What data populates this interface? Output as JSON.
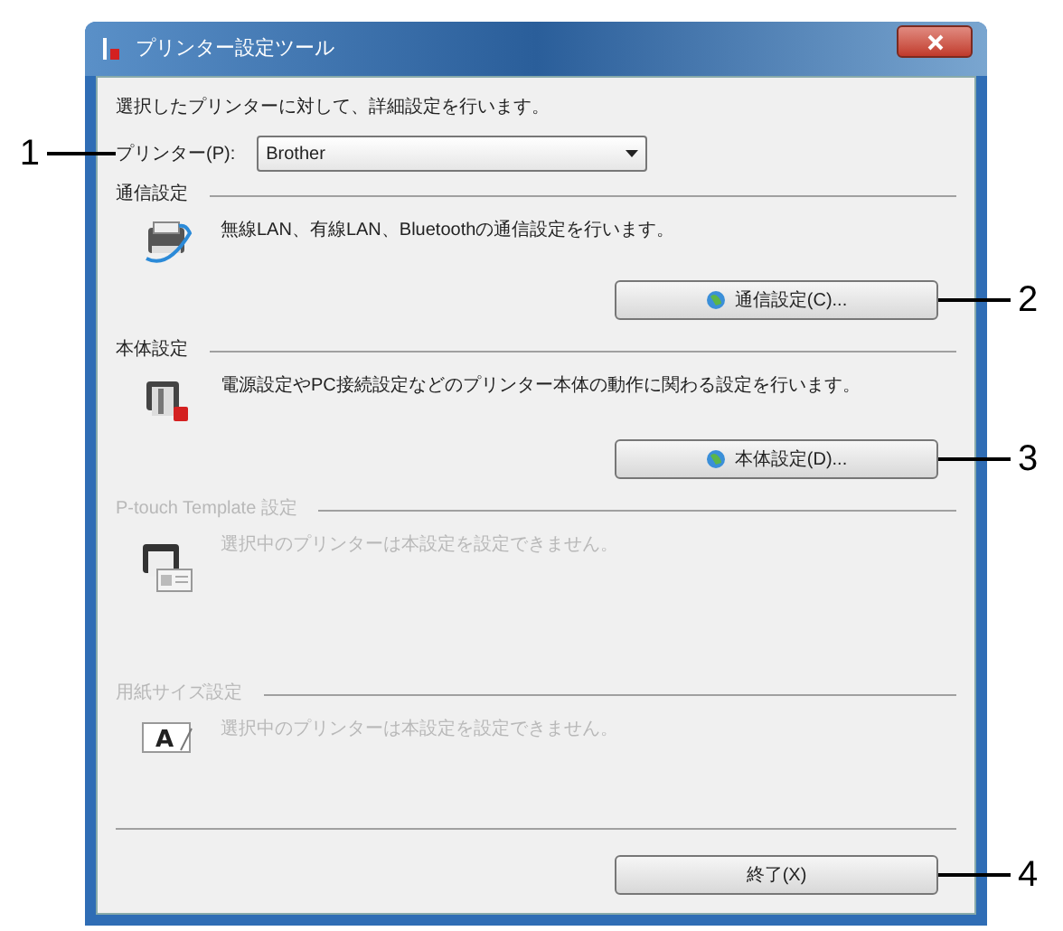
{
  "window": {
    "title": "プリンター設定ツール"
  },
  "intro": "選択したプリンターに対して、詳細設定を行います。",
  "printer": {
    "label": "プリンター(P):",
    "value": "Brother",
    "callout": "1"
  },
  "sections": [
    {
      "heading": "通信設定",
      "description": "無線LAN、有線LAN、Bluetoothの通信設定を行います。",
      "disabled": false,
      "button": {
        "label": "通信設定(C)...",
        "callout": "2"
      }
    },
    {
      "heading": "本体設定",
      "description": "電源設定やPC接続設定などのプリンター本体の動作に関わる設定を行います。",
      "disabled": false,
      "button": {
        "label": "本体設定(D)...",
        "callout": "3"
      }
    },
    {
      "heading": "P-touch Template 設定",
      "description": "選択中のプリンターは本設定を設定できません。",
      "disabled": true
    },
    {
      "heading": "用紙サイズ設定",
      "description": "選択中のプリンターは本設定を設定できません。",
      "disabled": true,
      "icon_text": "A"
    }
  ],
  "exit_button": {
    "label": "終了(X)",
    "callout": "4"
  }
}
